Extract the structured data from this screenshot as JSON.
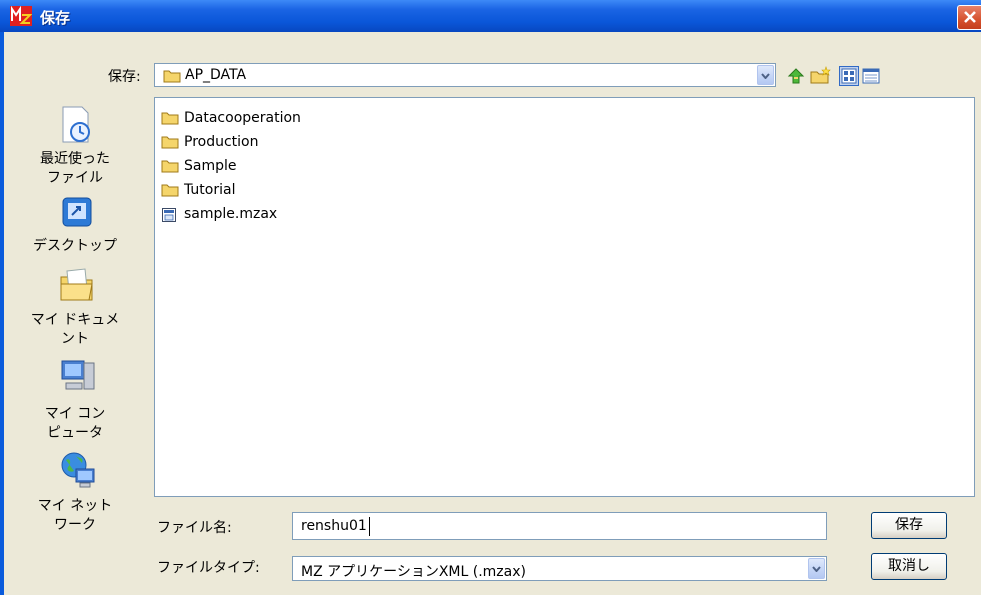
{
  "window": {
    "title": "保存",
    "logo_text": "MZ"
  },
  "save_in": {
    "label": "保存:",
    "value": "AP_DATA"
  },
  "toolbar": {
    "icons": [
      "up-folder-icon",
      "new-folder-icon",
      "view-list-icon",
      "view-details-icon"
    ]
  },
  "places": [
    {
      "label": "最近使った\nファイル",
      "icon": "recent-documents-icon"
    },
    {
      "label": "デスクトップ",
      "icon": "desktop-icon"
    },
    {
      "label": "マイ ドキュメ\nント",
      "icon": "my-documents-icon"
    },
    {
      "label": "マイ コン\nピュータ",
      "icon": "my-computer-icon"
    },
    {
      "label": "マイ ネット\nワーク",
      "icon": "my-network-icon"
    }
  ],
  "files": [
    {
      "name": "Datacooperation",
      "type": "folder"
    },
    {
      "name": "Production",
      "type": "folder"
    },
    {
      "name": "Sample",
      "type": "folder"
    },
    {
      "name": "Tutorial",
      "type": "folder"
    },
    {
      "name": "sample.mzax",
      "type": "file"
    }
  ],
  "filename": {
    "label": "ファイル名:",
    "value": "renshu01"
  },
  "filetype": {
    "label": "ファイルタイプ:",
    "value": "MZ アプリケーションXML (.mzax)"
  },
  "buttons": {
    "save": "保存",
    "cancel": "取消し"
  },
  "colors": {
    "titlebar": "#0a56d8",
    "dialog_bg": "#ece9d8",
    "close_button": "#d6512d",
    "folder": "#f5d56b"
  }
}
